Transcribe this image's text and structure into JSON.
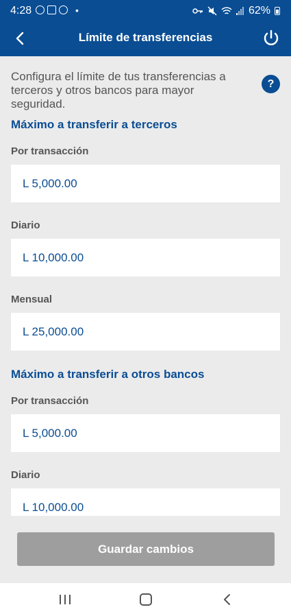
{
  "status_bar": {
    "time": "4:28",
    "battery": "62%"
  },
  "header": {
    "title": "Límite de transferencias"
  },
  "intro_text": "Configura el límite de tus transferencias a terceros y otros bancos para mayor seguridad.",
  "help_label": "?",
  "sections": [
    {
      "title": "Máximo a transferir a terceros",
      "fields": [
        {
          "label": "Por transacción",
          "value": "L 5,000.00"
        },
        {
          "label": "Diario",
          "value": "L 10,000.00"
        },
        {
          "label": "Mensual",
          "value": "L 25,000.00"
        }
      ]
    },
    {
      "title": "Máximo a transferir a otros bancos",
      "fields": [
        {
          "label": "Por transacción",
          "value": "L 5,000.00"
        },
        {
          "label": "Diario",
          "value": "L 10,000.00"
        }
      ]
    }
  ],
  "save_button": "Guardar cambios",
  "colors": {
    "primary": "#0a4d93",
    "disabled_button": "#9e9e9e",
    "background": "#ebebeb"
  }
}
